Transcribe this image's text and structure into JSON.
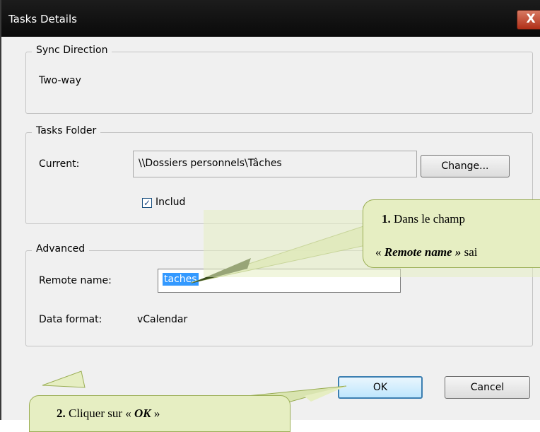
{
  "window": {
    "title": "Tasks Details",
    "close_label": "X"
  },
  "sync_direction": {
    "label": "Sync Direction",
    "value": "Two-way"
  },
  "tasks_folder": {
    "label": "Tasks Folder",
    "current_label": "Current:",
    "current_value": "\\\\Dossiers personnels\\Tâches",
    "change_button": "Change...",
    "include_label": "Includ"
  },
  "advanced": {
    "label": "Advanced",
    "remote_name_label": "Remote name:",
    "remote_name_value": "taches",
    "data_format_label": "Data format:",
    "data_format_value": "vCalendar"
  },
  "buttons": {
    "ok": "OK",
    "cancel": "Cancel"
  },
  "callout1": {
    "number": "1.",
    "line1": "Dans le champ",
    "line2_prefix": "«",
    "line2_em": "Remote name »",
    "line2_suffix": "sai"
  },
  "callout2": {
    "number": "2.",
    "prefix": "Cliquer sur «",
    "em": "OK",
    "suffix": "»"
  }
}
